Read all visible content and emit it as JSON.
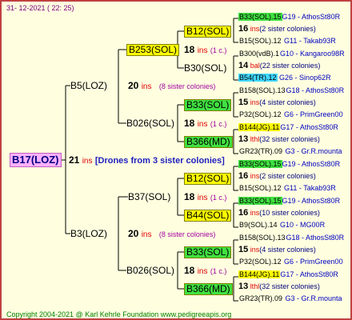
{
  "date": "31- 12-2021 ( 22: 25)",
  "footer": "Copyright 2004-2021 @ Karl Kehrle Foundation    www.pedigreeapis.org",
  "root": {
    "name": "B17(LOZ)",
    "num": "21",
    "ins": "ins",
    "note": "[Drones from 3 sister colonies]"
  },
  "mid": [
    {
      "name": "B5(LOZ)",
      "num": "20",
      "ins": "ins",
      "sis": "(8 sister colonies)"
    },
    {
      "name": "B3(LOZ)",
      "num": "20",
      "ins": "ins",
      "sis": "(8 sister colonies)"
    }
  ],
  "g2": [
    {
      "name": "B253(SOL)",
      "num": "18",
      "ins": "ins",
      "sis": "(1 c.)",
      "color": "yel"
    },
    {
      "name": "B026(SOL)",
      "num": "18",
      "ins": "ins",
      "sis": "(1 c.)",
      "color": "none"
    },
    {
      "name": "B37(SOL)",
      "num": "18",
      "ins": "ins",
      "sis": "(1 c.)",
      "color": "none"
    },
    {
      "name": "B026(SOL)",
      "num": "18",
      "ins": "ins",
      "sis": "(1 c.)",
      "color": "none"
    }
  ],
  "g3": [
    {
      "name": "B12(SOL)",
      "color": "yel"
    },
    {
      "name": "B30(SOL)",
      "color": "none"
    },
    {
      "name": "B33(SOL)",
      "color": "grn"
    },
    {
      "name": "B366(MD)",
      "color": "grn"
    },
    {
      "name": "B12(SOL)",
      "color": "yel"
    },
    {
      "name": "B44(SOL)",
      "color": "yel"
    },
    {
      "name": "B33(SOL)",
      "color": "grn"
    },
    {
      "name": "B366(MD)",
      "color": "grn"
    }
  ],
  "leaves": [
    {
      "l1": "B33(SOL).15",
      "l1c": "grn",
      "l1r": "G19 - AthosSt80R",
      "n": "16",
      "ins": "ins",
      "sis": "(2 sister colonies)",
      "l3": "B15(SOL).12",
      "l3r": "G11 - Takab93R"
    },
    {
      "l1": "B300(vdB).1",
      "l1c": "none",
      "l1r": "G10 - Kangaroo98R",
      "n": "14",
      "ins": "bal",
      "sis": "(22 sister colonies)",
      "l3": "B54(TR).12",
      "l3c": "cyan",
      "l3r": "G26 - Sinop62R"
    },
    {
      "l1": "B158(SOL).13",
      "l1c": "none",
      "l1r": "G18 - AthosSt80R",
      "n": "15",
      "ins": "ins",
      "sis": "(4 sister colonies)",
      "l3": "P32(SOL).12",
      "l3r": "G6 - PrimGreen00"
    },
    {
      "l1": "B144(JG).11",
      "l1c": "yel",
      "l1r": "G17 - AthosSt80R",
      "n": "13",
      "ins": "lthl",
      "sis": "(32 sister colonies)",
      "l3": "GR23(TR).09",
      "l3r": "G3 - Gr.R.mounta"
    },
    {
      "l1": "B33(SOL).15",
      "l1c": "grn",
      "l1r": "G19 - AthosSt80R",
      "n": "16",
      "ins": "ins",
      "sis": "(2 sister colonies)",
      "l3": "B15(SOL).12",
      "l3r": "G11 - Takab93R"
    },
    {
      "l1": "B33(SOL).15",
      "l1c": "grn",
      "l1r": "G19 - AthosSt80R",
      "n": "16",
      "ins": "ins",
      "sis": "(10 sister colonies)",
      "l3": "B9(SOL).14",
      "l3r": "G10 - MG00R"
    },
    {
      "l1": "B158(SOL).13",
      "l1c": "none",
      "l1r": "G18 - AthosSt80R",
      "n": "15",
      "ins": "ins",
      "sis": "(4 sister colonies)",
      "l3": "P32(SOL).12",
      "l3r": "G6 - PrimGreen00"
    },
    {
      "l1": "B144(JG).11",
      "l1c": "yel",
      "l1r": "G17 - AthosSt80R",
      "n": "13",
      "ins": "lthl",
      "sis": "(32 sister colonies)",
      "l3": "GR23(TR).09",
      "l3r": "G3 - Gr.R.mounta"
    }
  ]
}
